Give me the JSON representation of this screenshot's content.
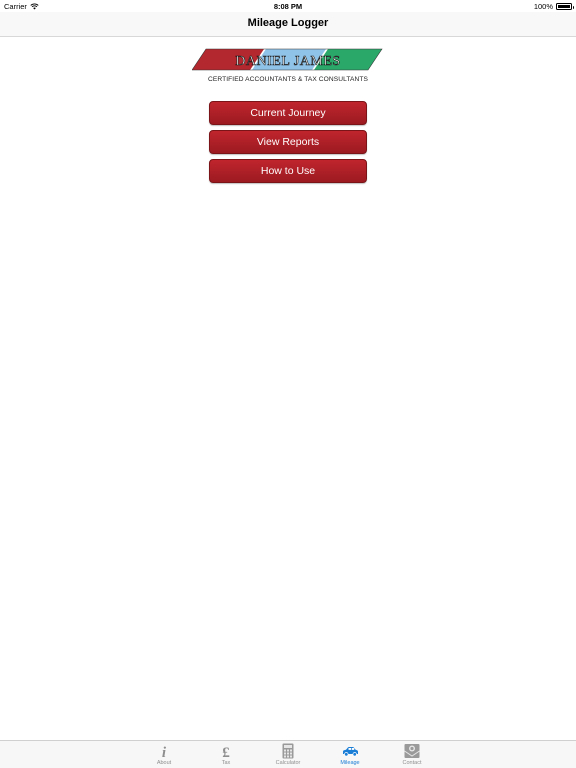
{
  "status_bar": {
    "carrier": "Carrier",
    "time": "8:08 PM",
    "battery": "100%"
  },
  "nav": {
    "title": "Mileage Logger"
  },
  "logo": {
    "name": "Daniel James",
    "caption": "Certified Accountants & Tax Consultants",
    "colors": [
      "#b3272e",
      "#8fc3e8",
      "#2aa86a"
    ]
  },
  "menu": {
    "buttons": [
      {
        "label": "Current Journey"
      },
      {
        "label": "View Reports"
      },
      {
        "label": "How to Use"
      }
    ],
    "button_color": "#b0222a"
  },
  "tab_bar": {
    "active_color": "#1a7dd6",
    "items": [
      {
        "label": "About",
        "icon": "info-icon",
        "active": false
      },
      {
        "label": "Tax",
        "icon": "pound-icon",
        "active": false
      },
      {
        "label": "Calculator",
        "icon": "calculator-icon",
        "active": false
      },
      {
        "label": "Mileage",
        "icon": "car-icon",
        "active": true
      },
      {
        "label": "Contact",
        "icon": "envelope-icon",
        "active": false
      }
    ]
  }
}
